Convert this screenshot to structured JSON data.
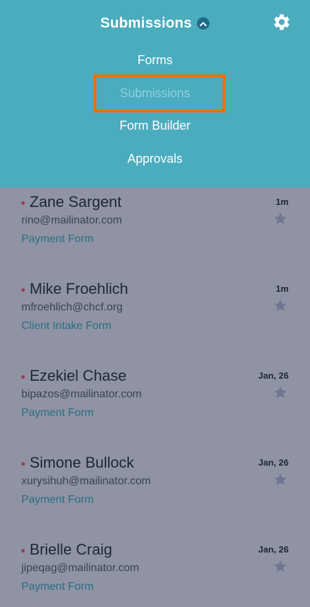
{
  "header": {
    "title": "Submissions",
    "menu": [
      "Forms",
      "Submissions",
      "Form Builder",
      "Approvals"
    ],
    "active_item": "Submissions"
  },
  "colors": {
    "header_bg": "#4bacbe",
    "overlay_bg": "#8f93a4",
    "highlight_border": "#ff6a13",
    "unread_dot": "#a23a3a",
    "form_link": "#2a6f82"
  },
  "submissions": [
    {
      "name": "Zane Sargent",
      "email": "rino@mailinator.com",
      "form": "Payment Form",
      "time": "1m"
    },
    {
      "name": "Mike Froehlich",
      "email": "mfroehlich@chcf.org",
      "form": "Client Intake Form",
      "time": "1m"
    },
    {
      "name": "Ezekiel Chase",
      "email": "bipazos@mailinator.com",
      "form": "Payment Form",
      "time": "Jan, 26"
    },
    {
      "name": "Simone Bullock",
      "email": "xurysihuh@mailinator.com",
      "form": "Payment Form",
      "time": "Jan, 26"
    },
    {
      "name": "Brielle Craig",
      "email": "jipeqag@mailinator.com",
      "form": "Payment Form",
      "time": "Jan, 26"
    }
  ],
  "icons": {
    "settings": "gear-icon",
    "toggle": "chevron-up-icon",
    "favorite": "star-icon",
    "unread": "unread-dot"
  }
}
